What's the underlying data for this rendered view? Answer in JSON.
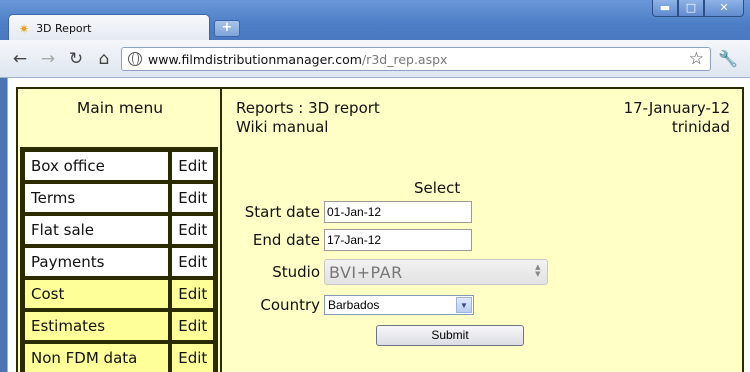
{
  "browser": {
    "tab_title": "3D Report",
    "new_tab_symbol": "+",
    "window_buttons": {
      "minimize": "▬",
      "maximize": "□",
      "close": "✕"
    },
    "nav": {
      "back": "←",
      "forward": "→",
      "reload": "↻",
      "home": "⌂"
    },
    "url_host": "www.filmdistributionmanager.com",
    "url_path": "/r3d_rep.aspx",
    "icons": [
      "tab-favicon-icon",
      "globe-icon",
      "bookmark-star-icon",
      "wrench-icon"
    ]
  },
  "menu": {
    "title": "Main menu",
    "edit_label": "Edit",
    "items": [
      {
        "label": "Box office",
        "style": "white"
      },
      {
        "label": "Terms",
        "style": "white"
      },
      {
        "label": "Flat sale",
        "style": "white"
      },
      {
        "label": "Payments",
        "style": "white"
      },
      {
        "label": "Cost",
        "style": "yellow"
      },
      {
        "label": "Estimates",
        "style": "yellow"
      },
      {
        "label": "Non FDM data",
        "style": "yellow"
      }
    ]
  },
  "header": {
    "breadcrumb": "Reports : 3D report",
    "wiki": "Wiki manual",
    "date": "17-January-12",
    "user": "trinidad"
  },
  "form": {
    "heading": "Select",
    "start_label": "Start date",
    "start_value": "01-Jan-12",
    "end_label": "End date",
    "end_value": "17-Jan-12",
    "studio_label": "Studio",
    "studio_value": "BVI+PAR",
    "country_label": "Country",
    "country_value": "Barbados",
    "submit_label": "Submit"
  },
  "colors": {
    "page_background": "#ffffc6",
    "menu_highlight": "#ffff99",
    "border": "#2b2b00",
    "titlebar": "#4d7ec6"
  }
}
